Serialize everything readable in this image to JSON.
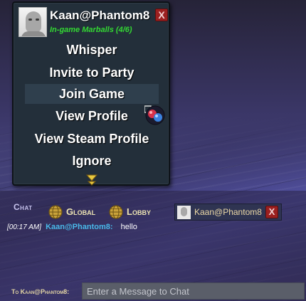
{
  "profile": {
    "username": "Kaan@Phantom8",
    "status": "In-game Marballs (4/6)",
    "close_label": "X"
  },
  "menu": {
    "items": [
      {
        "label": "Whisper"
      },
      {
        "label": "Invite to Party"
      },
      {
        "label": "Join Game"
      },
      {
        "label": "View Profile"
      },
      {
        "label": "View Steam Profile"
      },
      {
        "label": "Ignore"
      }
    ]
  },
  "chat": {
    "title": "Chat",
    "tabs": [
      {
        "label": "Global"
      },
      {
        "label": "Lobby"
      }
    ],
    "whisper_tab": {
      "name": "Kaan@Phantom8",
      "close_label": "X"
    },
    "messages": [
      {
        "time": "[00:17 AM]",
        "sender": "Kaan@Phantom8:",
        "text": "hello"
      }
    ],
    "to_label": "To Kaan@Phantom8:",
    "input_placeholder": "Enter a Message to Chat"
  },
  "colors": {
    "status_green": "#33d933",
    "sender_blue": "#49b8e8",
    "close_red": "#9b2020",
    "tab_gold": "#eee5b4"
  }
}
